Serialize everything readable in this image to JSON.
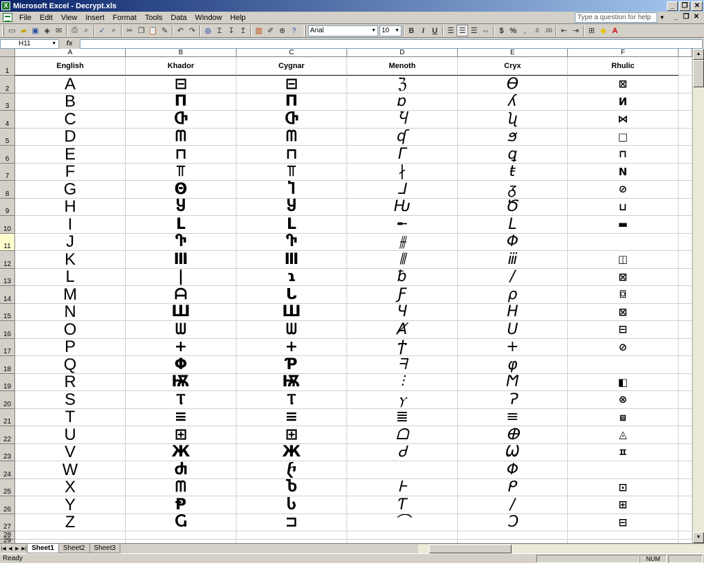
{
  "window": {
    "title": "Microsoft Excel - Decrypt.xls",
    "app_icon": "excel-icon",
    "controls": [
      "_",
      "□",
      "X"
    ]
  },
  "menu": {
    "items": [
      "File",
      "Edit",
      "View",
      "Insert",
      "Format",
      "Tools",
      "Data",
      "Window",
      "Help"
    ],
    "help_placeholder": "Type a question for help"
  },
  "toolbar": {
    "font": "Arial",
    "size": "10",
    "bold": "B",
    "italic": "I",
    "underline": "U",
    "currency": "$",
    "percent": "%"
  },
  "formula_bar": {
    "name_box": "H11",
    "fx": "fx",
    "content": ""
  },
  "columns": [
    "A",
    "B",
    "C",
    "D",
    "E",
    "F"
  ],
  "headers": [
    "English",
    "Khador",
    "Cygnar",
    "Menoth",
    "Cryx",
    "Rhulic"
  ],
  "rows": [
    {
      "num": "1"
    },
    {
      "num": "2",
      "cells": [
        "A",
        "⊟",
        "⊟",
        "ℨ",
        "ϴ",
        "⊠"
      ]
    },
    {
      "num": "3",
      "cells": [
        "B",
        "Π",
        "Π",
        "ɒ",
        "ʎ",
        "И"
      ]
    },
    {
      "num": "4",
      "cells": [
        "C",
        "Ⴇ",
        "Ⴇ",
        "Ⴏ",
        "ʯ",
        "⋈"
      ]
    },
    {
      "num": "5",
      "cells": [
        "D",
        "ᗰ",
        "ᗰ",
        "ʠ",
        "ϧ",
        "□"
      ]
    },
    {
      "num": "6",
      "cells": [
        "E",
        "⊓",
        "⊓",
        "Γ",
        "ꝗ",
        "⊓"
      ]
    },
    {
      "num": "7",
      "cells": [
        "F",
        "⫪",
        "⫪",
        "∤",
        "ŧ",
        "Ν"
      ]
    },
    {
      "num": "8",
      "cells": [
        "G",
        "Θ",
        "Ⴈ",
        "⅃",
        "ᵹ",
        "⊘"
      ]
    },
    {
      "num": "9",
      "cells": [
        "H",
        "Ⴘ",
        "Ⴘ",
        "Ԋ",
        "Ծ",
        "⊔"
      ]
    },
    {
      "num": "10",
      "cells": [
        "I",
        "L",
        "L",
        "╾",
        "L",
        "▬"
      ]
    },
    {
      "num": "11",
      "cells": [
        "J",
        "Ⴅ",
        "Ⴅ",
        "⫵",
        "Φ",
        ""
      ]
    },
    {
      "num": "12",
      "cells": [
        "K",
        "Ⅲ",
        "Ⅲ",
        "⫴",
        "ⅲ",
        "◫"
      ]
    },
    {
      "num": "13",
      "cells": [
        "L",
        "|",
        "ɿ",
        "ƀ",
        "/",
        "⊠"
      ]
    },
    {
      "num": "14",
      "cells": [
        "M",
        "ᗩ",
        "ᒐ",
        "Ƒ",
        "ρ",
        "⌼"
      ]
    },
    {
      "num": "15",
      "cells": [
        "N",
        "Ш",
        "Ш",
        "Ч",
        "H",
        "⊠"
      ]
    },
    {
      "num": "16",
      "cells": [
        "O",
        "ᗯ",
        "ᗯ",
        "Ⱥ",
        "Ս",
        "⊟"
      ]
    },
    {
      "num": "17",
      "cells": [
        "P",
        "+",
        "+",
        "Ϯ",
        "+",
        "⊘"
      ]
    },
    {
      "num": "18",
      "cells": [
        "Q",
        "Φ",
        "Ƥ",
        "ᖷ",
        "φ",
        ""
      ]
    },
    {
      "num": "19",
      "cells": [
        "R",
        "Ѭ",
        "Ѭ",
        "⫶",
        "Ϻ",
        "◧"
      ]
    },
    {
      "num": "20",
      "cells": [
        "S",
        "Ⲧ",
        "Ⲧ",
        "ⲩ",
        "Ɂ",
        "⊗"
      ]
    },
    {
      "num": "21",
      "cells": [
        "T",
        "≡",
        "≡",
        "≣",
        "≡",
        "⧈"
      ]
    },
    {
      "num": "22",
      "cells": [
        "U",
        "⊞",
        "⊞",
        "ᗝ",
        "ⴲ",
        "◬"
      ]
    },
    {
      "num": "23",
      "cells": [
        "V",
        "Ж",
        "Ж",
        "Ꮷ",
        "Ѡ",
        "ㅍ"
      ]
    },
    {
      "num": "24",
      "cells": [
        "W",
        "Ⴛ",
        "ⴡ",
        "",
        "Φ",
        ""
      ]
    },
    {
      "num": "25",
      "cells": [
        "X",
        "ᗰ",
        "Ⴆ",
        "Ꮀ",
        "ᑭ",
        "⊡"
      ]
    },
    {
      "num": "26",
      "cells": [
        "Y",
        "Ᵽ",
        "Ⴑ",
        "Ƭ",
        "/",
        "⊞"
      ]
    },
    {
      "num": "27",
      "cells": [
        "Z",
        "Ⴚ",
        "⊐",
        "⌒",
        "Ɔ",
        "⊟"
      ]
    },
    {
      "num": "28"
    },
    {
      "num": "29"
    }
  ],
  "sheets": [
    "Sheet1",
    "Sheet2",
    "Sheet3"
  ],
  "status": {
    "ready": "Ready",
    "num": "NUM"
  }
}
